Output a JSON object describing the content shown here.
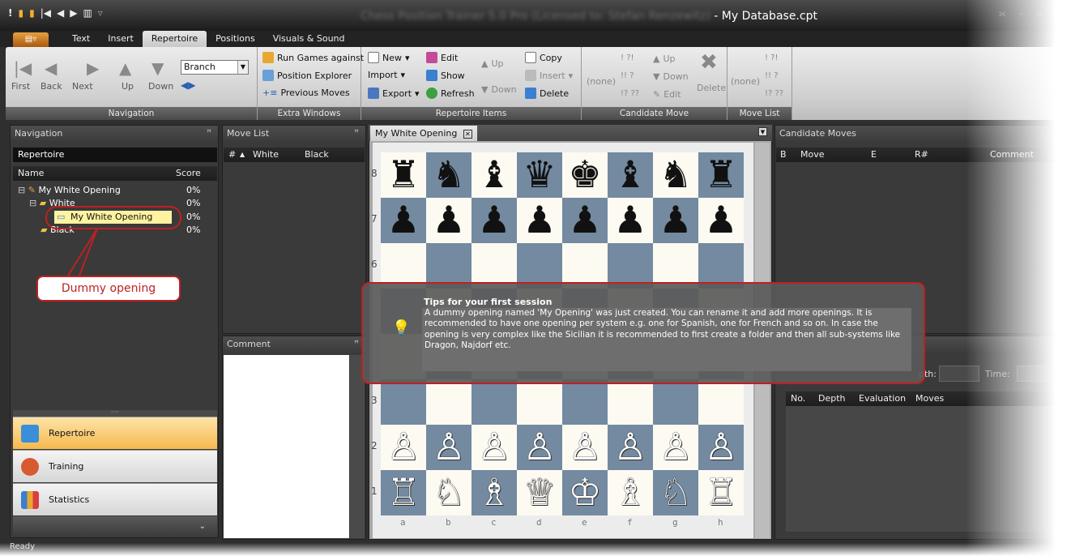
{
  "window": {
    "title_blurred": "Chess Position Trainer 5.0 Pro (Licensed to: Stefan Renzewitz)",
    "title_suffix": " - My Database.cpt"
  },
  "ribbon_tabs": [
    {
      "label": "Text"
    },
    {
      "label": "Insert"
    },
    {
      "label": "Repertoire"
    },
    {
      "label": "Positions"
    },
    {
      "label": "Visuals & Sound"
    }
  ],
  "ribbon": {
    "navigation": {
      "group_label": "Navigation",
      "first": "First",
      "back": "Back",
      "next": "Next",
      "up": "Up",
      "down": "Down",
      "branch_value": "Branch"
    },
    "extra_windows": {
      "group_label": "Extra Windows",
      "run_games": "Run Games against",
      "position_explorer": "Position Explorer",
      "previous_moves": "Previous Moves"
    },
    "repertoire_items": {
      "group_label": "Repertoire Items",
      "new": "New",
      "import": "Import",
      "export": "Export",
      "edit": "Edit",
      "show": "Show",
      "refresh": "Refresh",
      "up": "Up",
      "down": "Down",
      "copy": "Copy",
      "insert": "Insert",
      "delete": "Delete"
    },
    "candidate_move": {
      "group_label": "Candidate Move",
      "none": "(none)",
      "row1": "!    ?!",
      "row2": "!!    ?",
      "row3": "!?  ??",
      "up": "Up",
      "down": "Down",
      "edit": "Edit",
      "delete": "Delete"
    },
    "move_list": {
      "group_label": "Move List",
      "none": "(none)",
      "row1": "!    ?!",
      "row2": "!!    ?",
      "row3": "!?  ??"
    }
  },
  "navigation_panel": {
    "title": "Navigation",
    "subheader": "Repertoire",
    "col_name": "Name",
    "col_score": "Score",
    "tree": [
      {
        "label": "My White Opening",
        "score": "0%"
      },
      {
        "label": "White",
        "score": "0%"
      },
      {
        "label": "My White Opening",
        "score": "0%"
      },
      {
        "label": "Black",
        "score": "0%"
      }
    ],
    "callout": "Dummy opening"
  },
  "modules": [
    {
      "label": "Repertoire"
    },
    {
      "label": "Training"
    },
    {
      "label": "Statistics"
    }
  ],
  "move_list_panel": {
    "title": "Move List",
    "col_num": "#",
    "col_white": "White",
    "col_black": "Black"
  },
  "comment_panel": {
    "title": "Comment"
  },
  "board_tab": {
    "label": "My White Opening"
  },
  "board": {
    "ranks": [
      "8",
      "7",
      "6",
      "3",
      "2",
      "1"
    ],
    "files": [
      "a",
      "b",
      "c",
      "d",
      "e",
      "f",
      "g",
      "h"
    ],
    "pieces": {
      "rank8": [
        "♜",
        "♞",
        "♝",
        "♛",
        "♚",
        "♝",
        "♞",
        "♜"
      ],
      "rank7": [
        "♟",
        "♟",
        "♟",
        "♟",
        "♟",
        "♟",
        "♟",
        "♟"
      ],
      "rank2": [
        "♙",
        "♙",
        "♙",
        "♙",
        "♙",
        "♙",
        "♙",
        "♙"
      ],
      "rank1": [
        "♖",
        "♘",
        "♗",
        "♕",
        "♔",
        "♗",
        "♘",
        "♖"
      ]
    },
    "light_color": "#fdfaf2",
    "dark_color": "#738aa0"
  },
  "candidate_panel": {
    "title": "Candidate Moves",
    "col_b": "B",
    "col_move": "Move",
    "col_e": "E",
    "col_r": "R#",
    "col_comment": "Comment"
  },
  "engine_panel": {
    "depth_label": "pth:",
    "time_label": "Time:",
    "col_no": "No.",
    "col_depth": "Depth",
    "col_eval": "Evaluation",
    "col_moves": "Moves"
  },
  "tips": {
    "title": "Tips for your first session",
    "body": "A dummy opening named 'My Opening' was just created. You can rename it and add more openings. It is recommended to have one opening per system e.g. one for Spanish, one for French and so on. In case the opening is very complex like the Sicilian it is recommended to first create a folder and then all sub-systems like Dragon, Najdorf etc."
  },
  "status": "Ready"
}
